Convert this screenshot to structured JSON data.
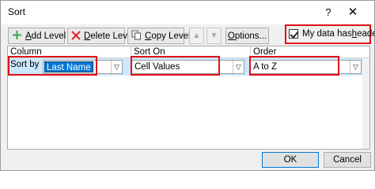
{
  "window": {
    "title": "Sort",
    "help_label": "?",
    "close_label": "✕"
  },
  "toolbar": {
    "add_level": {
      "hotkey": "A",
      "rest": "dd Level",
      "icon": "plus-icon"
    },
    "delete_level": {
      "hotkey": "D",
      "rest": "elete Level",
      "icon": "x-icon"
    },
    "copy_level": {
      "hotkey": "C",
      "rest": "opy Level",
      "icon": "copy-icon"
    },
    "move_up": {
      "icon": "up-arrow-icon",
      "label": "▲"
    },
    "move_down": {
      "icon": "down-arrow-icon",
      "label": "▼"
    },
    "options": {
      "hotkey": "O",
      "rest": "ptions..."
    },
    "headers_checkbox": {
      "label_before": "My data has ",
      "hotkey": "h",
      "label_after": "eaders",
      "checked": true
    }
  },
  "grid": {
    "columns": [
      "Column",
      "Sort On",
      "Order"
    ],
    "rows": [
      {
        "label": "Sort by",
        "column": "Last Name",
        "sort_on": "Cell Values",
        "order": "A to Z"
      }
    ],
    "dropdown_glyph": "▽"
  },
  "footer": {
    "ok_label": "OK",
    "cancel_label": "Cancel"
  },
  "colors": {
    "highlight": "#e0101a",
    "selection": "#0078d7",
    "row_selected": "#cce8ff"
  }
}
